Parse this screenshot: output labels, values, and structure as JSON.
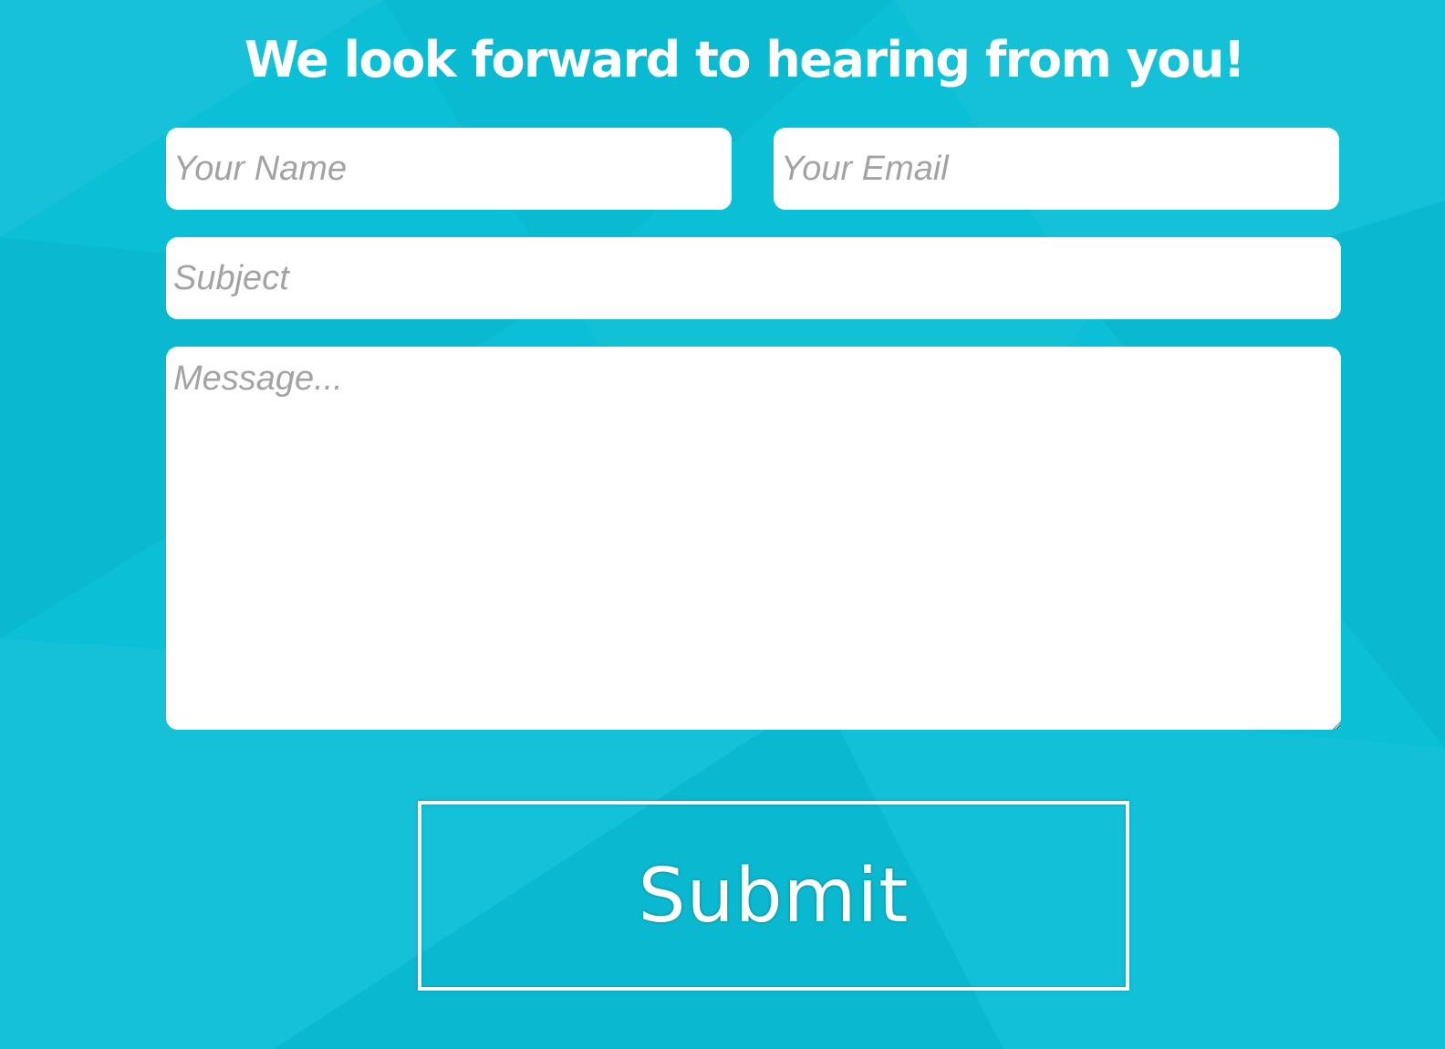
{
  "theme": {
    "background": "#0bbfd6",
    "foreground": "#ffffff",
    "placeholder_color": "#a3a3a3"
  },
  "contact_form": {
    "heading": "We look forward to hearing from you!",
    "name_placeholder": "Your Name",
    "email_placeholder": "Your Email",
    "subject_placeholder": "Subject",
    "message_placeholder": "Message...",
    "submit_label": "Submit"
  }
}
